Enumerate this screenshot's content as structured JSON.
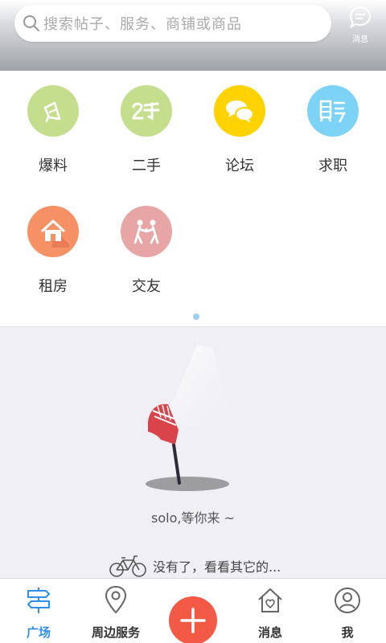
{
  "search": {
    "placeholder": "搜索帖子、服务、商铺或商品"
  },
  "header_message": {
    "label": "消息",
    "icon": "chat-bubble-icon"
  },
  "categories": [
    {
      "label": "爆料",
      "icon": "megaphone-icon",
      "color": "#c4de8e"
    },
    {
      "label": "二手",
      "icon": "secondhand-icon",
      "color": "#c4de8e"
    },
    {
      "label": "论坛",
      "icon": "forum-icon",
      "color": "#ffd200"
    },
    {
      "label": "求职",
      "icon": "job-icon",
      "color": "#7dd3f5"
    },
    {
      "label": "租房",
      "icon": "house-icon",
      "color": "#f69166"
    },
    {
      "label": "交友",
      "icon": "friends-icon",
      "color": "#e7a5a5"
    }
  ],
  "empty_state": {
    "text": "solo,等你来 ~",
    "more_text": "没有了，看看其它的...",
    "illustration": "microphone-spotlight-icon",
    "more_icon": "bicycle-icon"
  },
  "tabs": [
    {
      "label": "广场",
      "icon": "signpost-icon",
      "active": true
    },
    {
      "label": "周边服务",
      "icon": "location-pin-icon",
      "active": false
    },
    {
      "label": "",
      "icon": "plus-icon",
      "active": false
    },
    {
      "label": "消息",
      "icon": "home-heart-icon",
      "active": false
    },
    {
      "label": "我",
      "icon": "user-icon",
      "active": false
    }
  ],
  "colors": {
    "accent": "#2e8ee8",
    "plus_button": "#f25a45",
    "page_dot": "#9ccff3"
  }
}
